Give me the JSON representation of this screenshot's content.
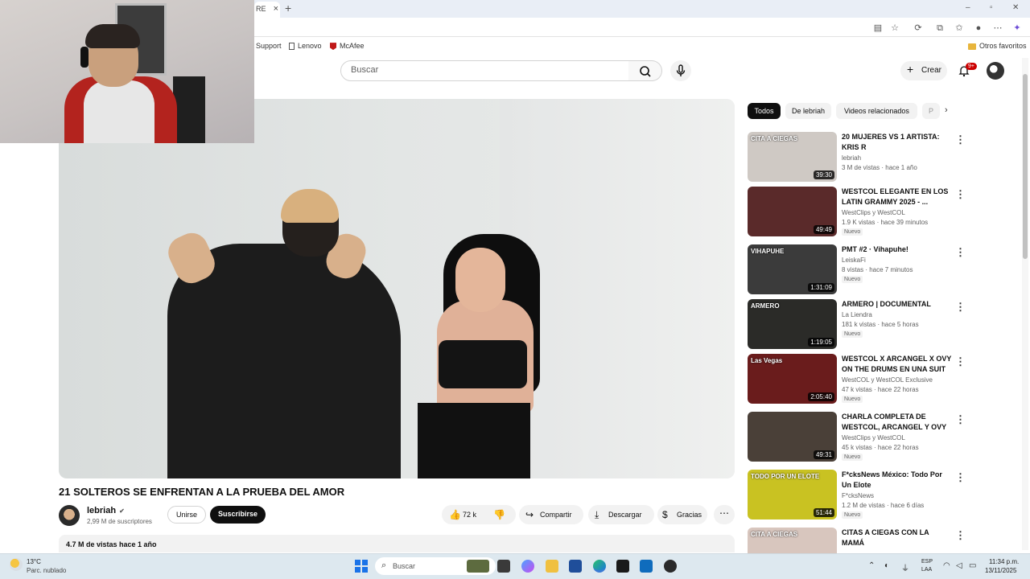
{
  "browser": {
    "tab_fragment": "RE",
    "tab_close": "×",
    "new_tab": "+",
    "favorites": [
      "Support",
      "Lenovo",
      "McAfee"
    ],
    "other_favorites": "Otros favoritos"
  },
  "youtube_header": {
    "search_placeholder": "Buscar",
    "create_label": "Crear",
    "notifications_badge": "9+"
  },
  "video": {
    "title": "21 SOLTEROS SE ENFRENTAN A LA PRUEBA DEL AMOR",
    "channel_name": "lebriah",
    "subscribers": "2,99 M de suscriptores",
    "join_label": "Unirse",
    "subscribe_label": "Suscribirse",
    "likes": "72 k",
    "share_label": "Compartir",
    "download_label": "Descargar",
    "thanks_label": "Gracias",
    "views_date": "4.7 M de vistas  hace 1 año"
  },
  "chips": [
    "Todos",
    "De lebriah",
    "Videos relacionados",
    "P"
  ],
  "recommendations": [
    {
      "title": "20 MUJERES VS 1 ARTISTA: KRIS R",
      "channel": "lebriah",
      "meta": "3 M de vistas · hace 1 año",
      "duration": "39:30",
      "badge": "",
      "thumb_color": "#cfc9c4",
      "thumb_text": "CITA A CIEGAS"
    },
    {
      "title": "WESTCOL ELEGANTE EN LOS LATIN GRAMMY 2025 - ...",
      "channel": "WestClips  y WestCOL",
      "meta": "1.9 K vistas · hace 39 minutos",
      "duration": "49:49",
      "badge": "Nuevo",
      "thumb_color": "#5a2a2a",
      "thumb_text": ""
    },
    {
      "title": "PMT #2 · Vihapuhe!",
      "channel": "LeiskaFi",
      "meta": "8 vistas · hace 7 minutos",
      "duration": "1:31:09",
      "badge": "Nuevo",
      "thumb_color": "#3b3b3b",
      "thumb_text": "VIHAPUHE"
    },
    {
      "title": "ARMERO | DOCUMENTAL",
      "channel": "La Liendra",
      "meta": "181 k vistas · hace 5 horas",
      "duration": "1:19:05",
      "badge": "Nuevo",
      "thumb_color": "#2b2b28",
      "thumb_text": "ARMERO"
    },
    {
      "title": "WESTCOL X ARCANGEL X OVY ON THE DRUMS EN UNA SUIT ...",
      "channel": "WestCOL  y WestCOL Exclusive",
      "meta": "47 k vistas · hace 22 horas",
      "duration": "2:05:40",
      "badge": "Nuevo",
      "thumb_color": "#6a1c1c",
      "thumb_text": "Las Vegas"
    },
    {
      "title": "CHARLA COMPLETA DE WESTCOL, ARCANGEL Y OVY ...",
      "channel": "WestClips  y WestCOL",
      "meta": "45 k vistas · hace 22 horas",
      "duration": "49:31",
      "badge": "Nuevo",
      "thumb_color": "#4a4038",
      "thumb_text": ""
    },
    {
      "title": "F*cksNews México: Todo Por Un Elote",
      "channel": "F*cksNews",
      "meta": "1.2 M de vistas · hace 6 días",
      "duration": "51:44",
      "badge": "Nuevo",
      "thumb_color": "#c9c222",
      "thumb_text": "TODO POR UN ELOTE"
    },
    {
      "title": "CITAS A CIEGAS CON LA MAMÁ",
      "channel": "",
      "meta": "",
      "duration": "",
      "badge": "",
      "thumb_color": "#d8c6be",
      "thumb_text": "CITA A CIEGAS"
    }
  ],
  "taskbar": {
    "temperature": "13°C",
    "weather": "Parc. nublado",
    "search_label": "Buscar",
    "lang_top": "ESP",
    "lang_bottom": "LAA",
    "time": "11:34 p.m.",
    "date": "13/11/2025"
  }
}
